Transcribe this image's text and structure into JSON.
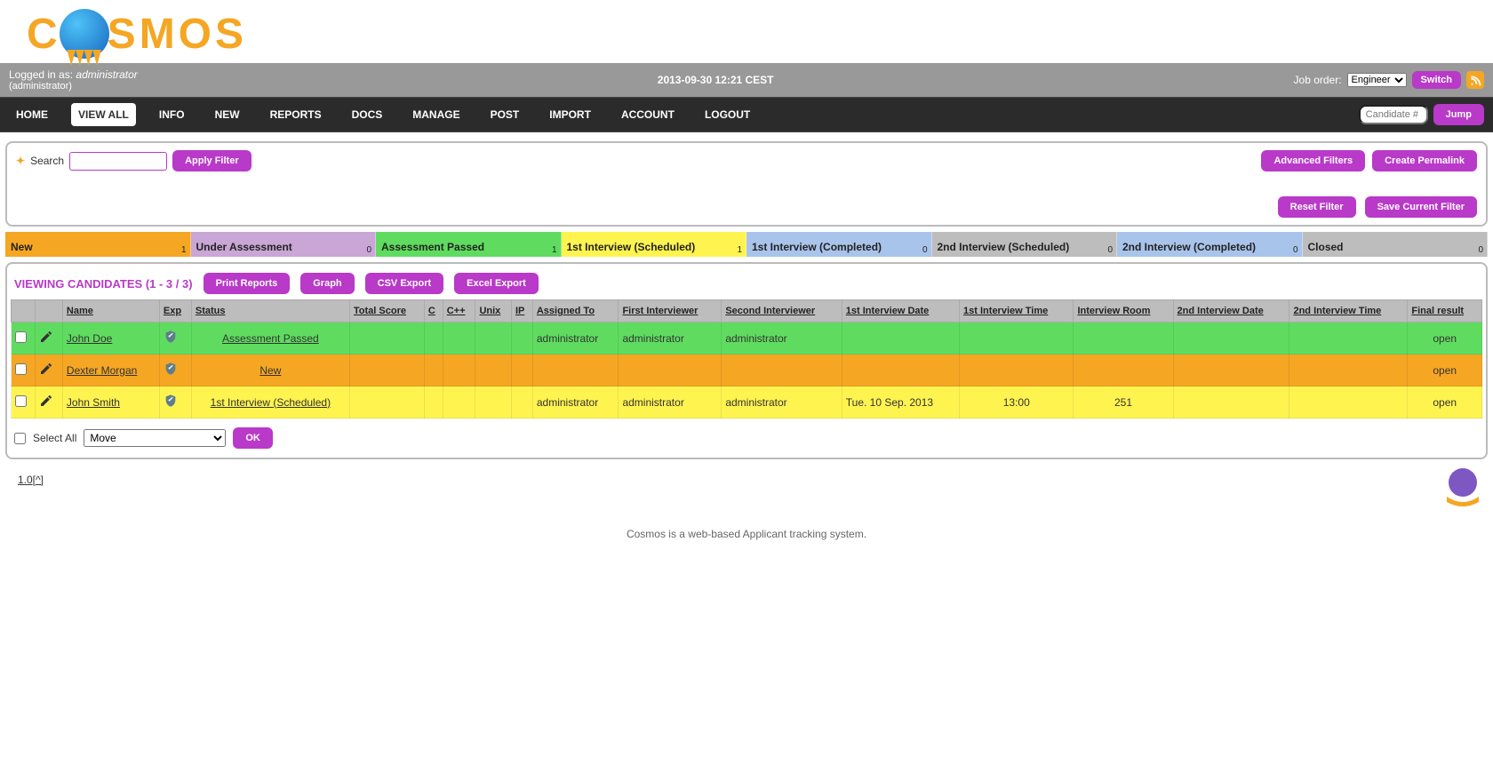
{
  "logo_text_parts": [
    "C",
    "SMOS"
  ],
  "infobar": {
    "logged_in_label": "Logged in as:",
    "username": "administrator",
    "role": "(administrator)",
    "datetime": "2013-09-30 12:21 CEST",
    "job_order_label": "Job order:",
    "job_order_value": "Engineer",
    "switch": "Switch"
  },
  "nav": {
    "items": [
      "HOME",
      "VIEW ALL",
      "INFO",
      "NEW",
      "REPORTS",
      "DOCS",
      "MANAGE",
      "POST",
      "IMPORT",
      "ACCOUNT",
      "LOGOUT"
    ],
    "active": "VIEW ALL",
    "jump_placeholder": "Candidate #",
    "jump_btn": "Jump"
  },
  "filter": {
    "search_label": "Search",
    "apply": "Apply Filter",
    "advanced": "Advanced Filters",
    "permalink": "Create Permalink",
    "reset": "Reset Filter",
    "save": "Save Current Filter"
  },
  "stages": [
    {
      "label": "New",
      "count": 1,
      "cls": "st-new"
    },
    {
      "label": "Under Assessment",
      "count": 0,
      "cls": "st-under"
    },
    {
      "label": "Assessment Passed",
      "count": 1,
      "cls": "st-passed"
    },
    {
      "label": "1st Interview (Scheduled)",
      "count": 1,
      "cls": "st-1s"
    },
    {
      "label": "1st Interview (Completed)",
      "count": 0,
      "cls": "st-1c"
    },
    {
      "label": "2nd Interview (Scheduled)",
      "count": 0,
      "cls": "st-2s"
    },
    {
      "label": "2nd Interview (Completed)",
      "count": 0,
      "cls": "st-2c"
    },
    {
      "label": "Closed",
      "count": 0,
      "cls": "st-closed"
    }
  ],
  "viewing": {
    "title": "VIEWING CANDIDATES (1 - 3 / 3)",
    "print": "Print Reports",
    "graph": "Graph",
    "csv": "CSV Export",
    "excel": "Excel Export"
  },
  "columns": [
    "",
    "",
    "Name",
    "Exp",
    "Status",
    "Total Score",
    "C",
    "C++",
    "Unix",
    "IP",
    "Assigned To",
    "First Interviewer",
    "Second Interviewer",
    "1st Interview Date",
    "1st Interview Time",
    "Interview Room",
    "2nd Interview Date",
    "2nd Interview Time",
    "Final result"
  ],
  "rows": [
    {
      "cls": "row-green",
      "name": "John Doe",
      "status": "Assessment Passed",
      "assigned_to": "administrator",
      "first_int": "administrator",
      "second_int": "administrator",
      "date1": "",
      "time1": "",
      "room": "",
      "date2": "",
      "time2": "",
      "final": "open"
    },
    {
      "cls": "row-orange",
      "name": "Dexter Morgan",
      "status": "New",
      "assigned_to": "",
      "first_int": "",
      "second_int": "",
      "date1": "",
      "time1": "",
      "room": "",
      "date2": "",
      "time2": "",
      "final": "open"
    },
    {
      "cls": "row-yellow",
      "name": "John Smith",
      "status": "1st Interview (Scheduled)",
      "assigned_to": "administrator",
      "first_int": "administrator",
      "second_int": "administrator",
      "date1": "Tue. 10 Sep. 2013",
      "time1": "13:00",
      "room": "251",
      "date2": "",
      "time2": "",
      "final": "open"
    }
  ],
  "bulk": {
    "select_all": "Select All",
    "action": "Move",
    "ok": "OK"
  },
  "footer": {
    "version": "1.0[^]",
    "tagline": "Cosmos is a web-based Applicant tracking system."
  }
}
